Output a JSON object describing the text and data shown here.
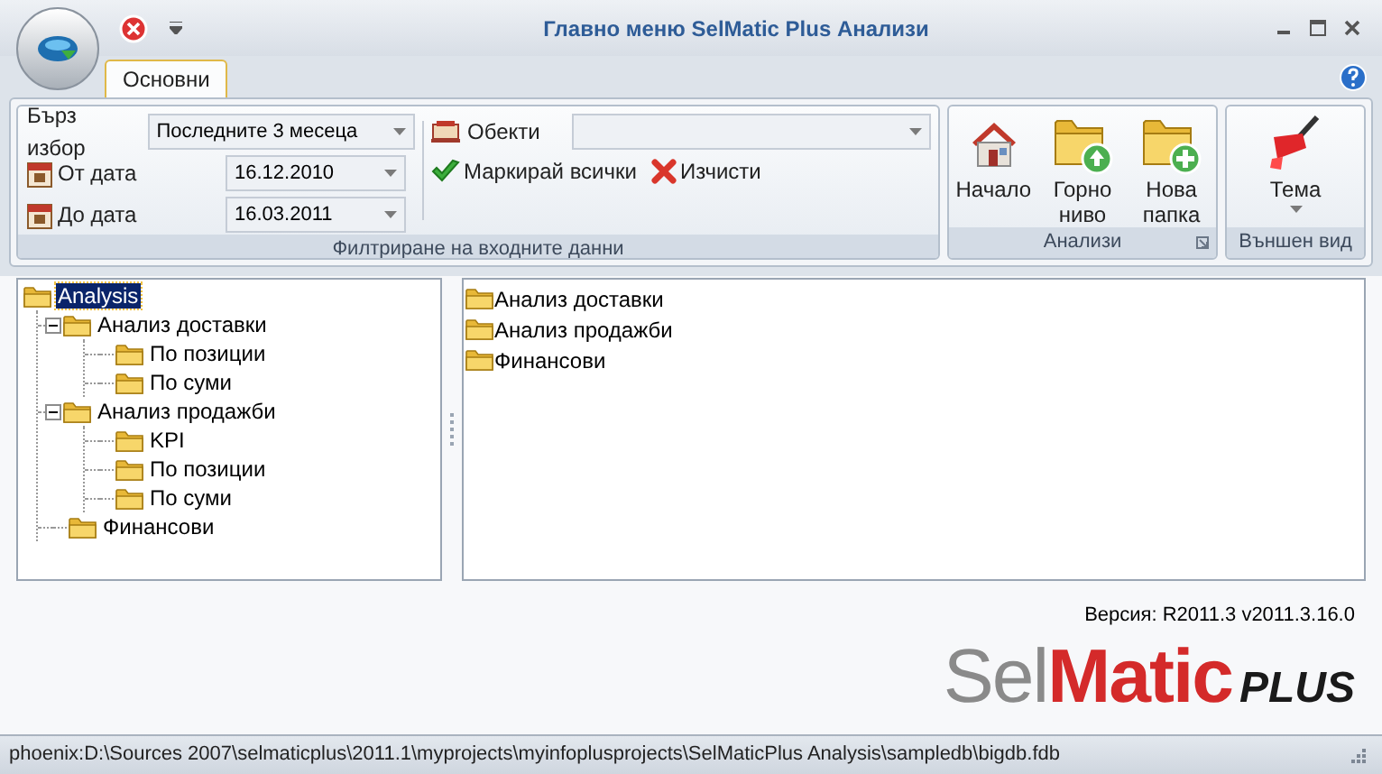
{
  "window": {
    "title": "Главно меню SelMatic Plus Анализи"
  },
  "tabs": [
    {
      "label": "Основни",
      "selected": true
    }
  ],
  "filter_group": {
    "quick_pick": {
      "label": "Бърз избор",
      "value": "Последните 3 месеца"
    },
    "from_date": {
      "label": "От дата",
      "value": "16.12.2010"
    },
    "to_date": {
      "label": "До дата",
      "value": "16.03.2011"
    },
    "objects": {
      "label": "Обекти"
    },
    "actions": [
      {
        "kind": "check",
        "label": "Маркирай всички"
      },
      {
        "kind": "clear",
        "label": "Изчисти"
      }
    ],
    "caption": "Филтриране на входните данни"
  },
  "analyses_group": {
    "buttons": [
      {
        "kind": "home",
        "label": "Начало"
      },
      {
        "kind": "up",
        "label": "Горно ниво"
      },
      {
        "kind": "new",
        "label": "Нова папка"
      }
    ],
    "caption": "Анализи"
  },
  "appearance_group": {
    "button": {
      "label": "Тема"
    },
    "caption": "Външен вид"
  },
  "tree": [
    {
      "label": "Analysis",
      "selected": true,
      "children": [
        {
          "label": "Анализ доставки",
          "selected": false,
          "expanded": true,
          "children": [
            {
              "label": "По позиции",
              "selected": false
            },
            {
              "label": "По суми",
              "selected": false
            }
          ]
        },
        {
          "label": "Анализ продажби",
          "selected": false,
          "expanded": true,
          "children": [
            {
              "label": "KPI",
              "selected": false
            },
            {
              "label": "По позиции",
              "selected": false
            },
            {
              "label": "По суми",
              "selected": false
            }
          ]
        },
        {
          "label": "Финансови",
          "selected": false
        }
      ]
    }
  ],
  "list": [
    {
      "label": "Анализ доставки"
    },
    {
      "label": "Анализ продажби"
    },
    {
      "label": "Финансови"
    }
  ],
  "version": "Версия: R2011.3 v2011.3.16.0",
  "logo": {
    "part_1": "Sel",
    "part_2": "Matic",
    "part_3": "PLUS"
  },
  "status_bar": "phoenix:D:\\Sources 2007\\selmaticplus\\2011.1\\myprojects\\myinfoplusprojects\\SelMaticPlus Analysis\\sampledb\\bigdb.fdb"
}
